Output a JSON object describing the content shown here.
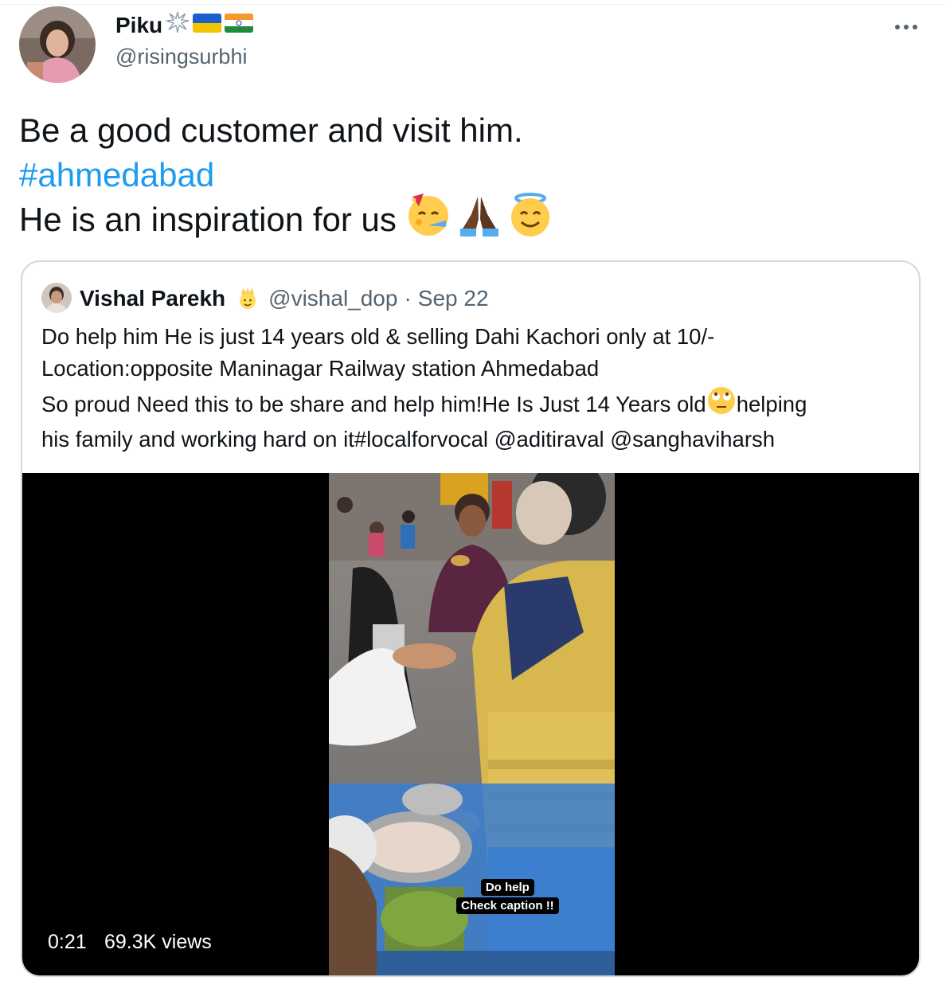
{
  "tweet": {
    "author": {
      "name": "Piku",
      "handle": "@risingsurbhi",
      "name_emojis": [
        "sparkle-burst-emoji",
        "ukraine-flag-emoji",
        "india-flag-emoji"
      ]
    },
    "text": {
      "line1": "Be a good customer and visit him.",
      "hashtag": "#ahmedabad",
      "line3": "He is an inspiration for us",
      "line3_emojis": [
        "partying-face-emoji",
        "folded-hands-emoji",
        "smiling-face-with-halo-emoji"
      ]
    },
    "colors": {
      "link": "#1d9bf0",
      "secondary": "#536471",
      "border": "#cfd9de"
    }
  },
  "quote": {
    "author": {
      "name": "Vishal Parekh",
      "badge_emoji": "person-with-crown-emoji",
      "handle": "@vishal_dop",
      "separator": "·",
      "date": "Sep 22"
    },
    "text": {
      "line1": "Do help him He is just 14 years old & selling Dahi Kachori only at 10/-",
      "line2": "Location:opposite Maninagar Railway station Ahmedabad",
      "line3_a": "So proud Need this to be share and help him!He Is Just 14 Years old",
      "line3_b": "helping",
      "line4_a": "his family and working hard on it ",
      "hashtag": "#localforvocal",
      "mention1": "@aditiraval",
      "mention2": "@sanghaviharsh"
    },
    "video": {
      "duration": "0:21",
      "views": "69.3K views",
      "caption_line1": "Do help",
      "caption_line2": "Check caption !!"
    }
  }
}
